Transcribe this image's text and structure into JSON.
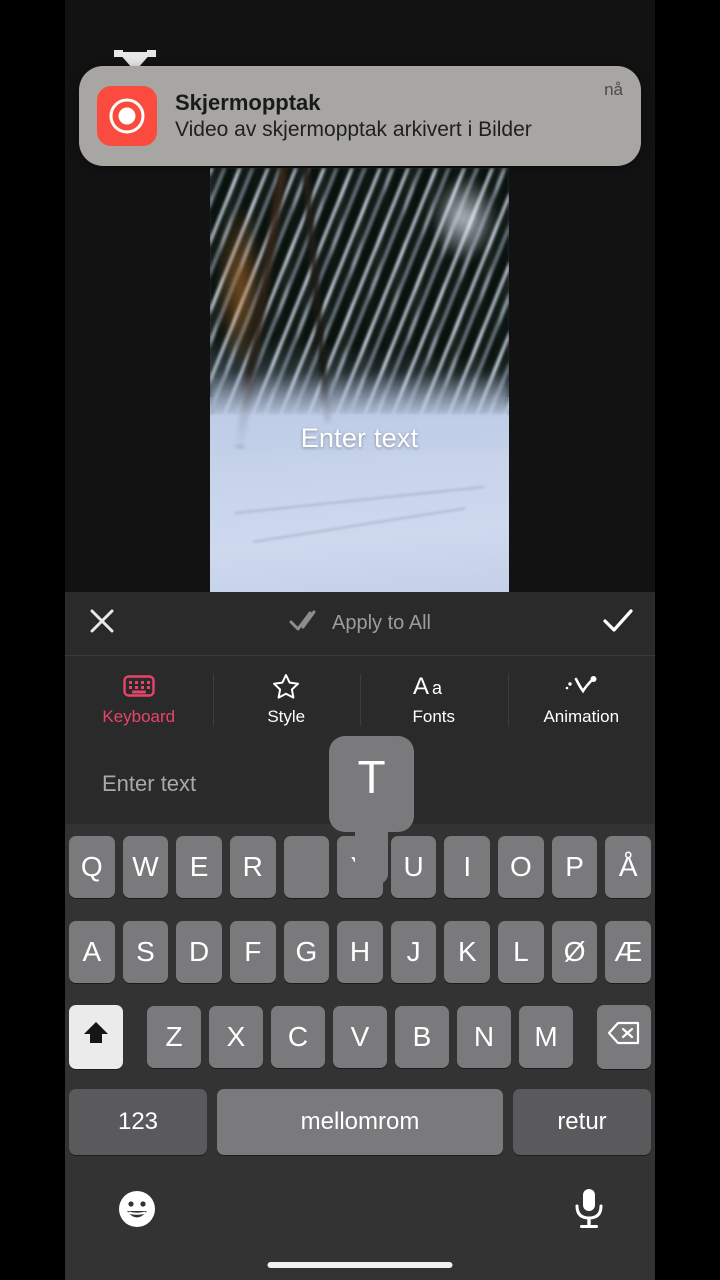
{
  "notification": {
    "app_icon": "screen-recording-icon",
    "overlap_logo": "capcut-logo-icon",
    "title": "Skjermopptak",
    "message": "Video av skjermopptak arkivert i Bilder",
    "time": "nå",
    "icon_color": "#FB4B3E",
    "banner_color": "#A8A6A3"
  },
  "preview": {
    "text_overlay": "Enter text",
    "description": "motion-blurred snowy forest video frame"
  },
  "action_bar": {
    "close_icon": "close-icon",
    "apply_all_icon": "double-check-icon",
    "apply_all_label": "Apply to All",
    "confirm_icon": "check-icon"
  },
  "tabs": [
    {
      "label": "Keyboard",
      "icon": "keyboard-icon",
      "active": true
    },
    {
      "label": "Style",
      "icon": "star-icon",
      "active": false
    },
    {
      "label": "Fonts",
      "icon": "aa-text-icon",
      "active": false
    },
    {
      "label": "Animation",
      "icon": "animation-icon",
      "active": false
    }
  ],
  "text_input": {
    "value": "",
    "placeholder": "Enter text"
  },
  "key_popup": {
    "letter": "T"
  },
  "keyboard": {
    "layout": "Norwegian QWERTY",
    "row1": [
      "Q",
      "W",
      "E",
      "R",
      "T",
      "Y",
      "U",
      "I",
      "O",
      "P",
      "Å"
    ],
    "row2": [
      "A",
      "S",
      "D",
      "F",
      "G",
      "H",
      "J",
      "K",
      "L",
      "Ø",
      "Æ"
    ],
    "row3": [
      "Z",
      "X",
      "C",
      "V",
      "B",
      "N",
      "M"
    ],
    "shift_icon": "shift-up-arrow-icon",
    "shift_active": true,
    "backspace_icon": "backspace-icon",
    "numbers_label": "123",
    "space_label": "mellomrom",
    "return_label": "retur"
  },
  "bottom_bar": {
    "emoji_icon": "emoji-smiley-icon",
    "mic_icon": "microphone-icon",
    "home_indicator": "home-indicator"
  },
  "colors": {
    "accent_pink": "#E8446B",
    "panel": "#2A2A2B",
    "keyboard_bg": "#333334",
    "key": "#7A7A7C",
    "key_dark": "#5A5A5C"
  }
}
